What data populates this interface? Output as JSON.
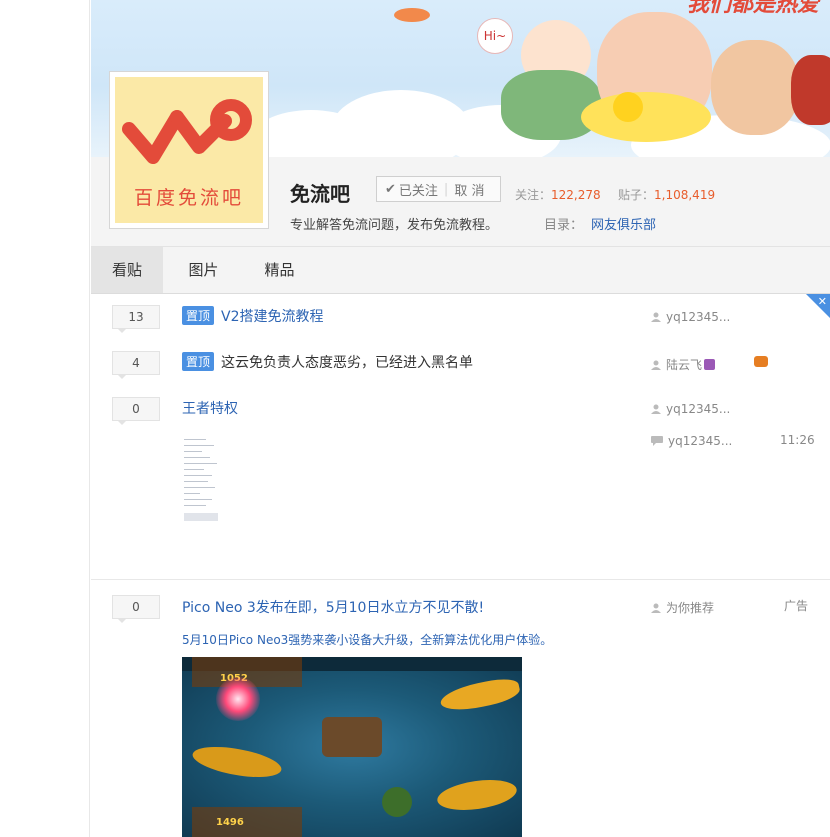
{
  "forum": {
    "logo_text": "百度免流吧",
    "name": "免流吧",
    "follow_label": "已关注",
    "unfollow_label": "取 消",
    "stats_follow_label": "关注：",
    "stats_follow_value": "122,278",
    "stats_posts_label": "贴子：",
    "stats_posts_value": "1,108,419",
    "description": "专业解答免流问题，发布免流教程。",
    "catalog_label": "目录：",
    "catalog_value": "网友俱乐部"
  },
  "tabs": [
    {
      "label": "看贴"
    },
    {
      "label": "图片"
    },
    {
      "label": "精品"
    }
  ],
  "posts": [
    {
      "replies": "13",
      "tag": "置顶",
      "title": "V2搭建免流教程",
      "author": "yq12345..."
    },
    {
      "replies": "4",
      "tag": "置顶",
      "title": "这云免负责人态度恶劣，已经进入黑名单",
      "author": "陆云飞"
    },
    {
      "replies": "0",
      "title": "王者特权",
      "author": "yq12345...",
      "last_reply_author": "yq12345...",
      "last_reply_time": "11:26"
    },
    {
      "replies": "0",
      "title": "Pico Neo 3发布在即，5月10日水立方不见不散!",
      "author": "为你推荐",
      "badge": "广告",
      "subtitle": "5月10日Pico Neo3强势来袭小设备大升级，全新算法优化用户体验。"
    }
  ],
  "banner_text": "我们都是热爱",
  "banner_hi": "Hi~",
  "game_scores": {
    "top": "1052",
    "bottom": "1496"
  },
  "colors": {
    "link": "#2d64b3",
    "tag": "#4a90e2",
    "stat_value": "#e85d2c",
    "logo_red": "#e34b3a",
    "logo_bg": "#fbe9a7"
  },
  "icons": [
    "user-icon",
    "reply-icon",
    "check-icon",
    "close-icon",
    "game-icon"
  ]
}
